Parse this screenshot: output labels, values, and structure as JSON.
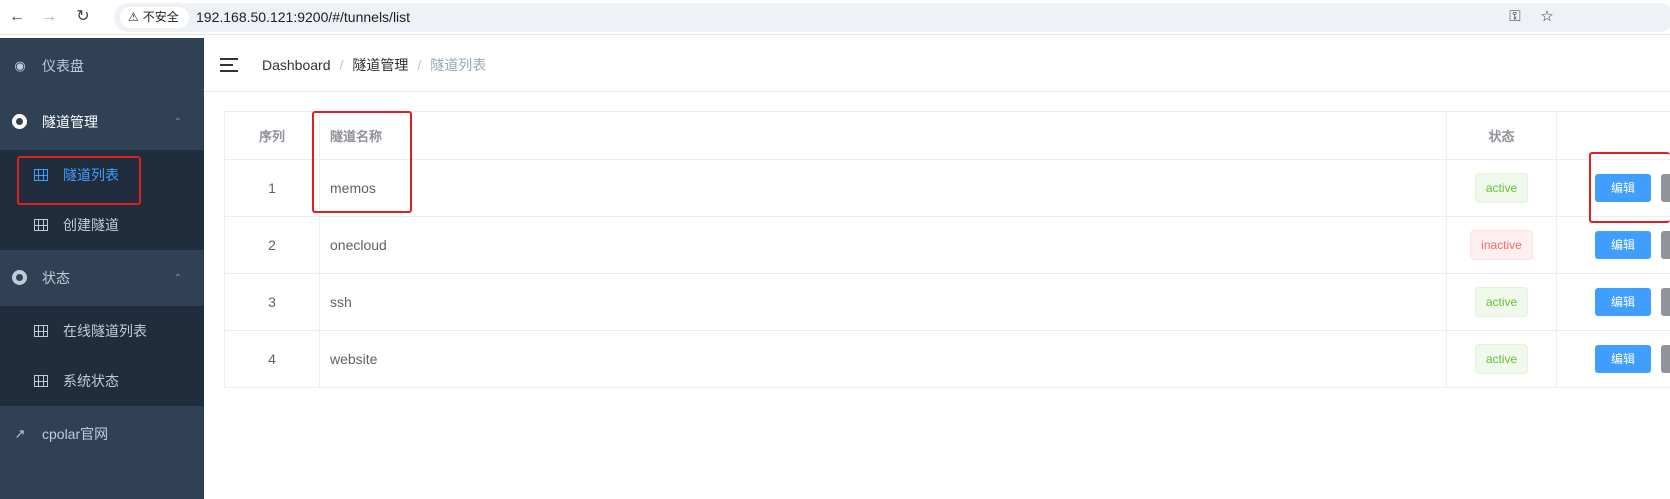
{
  "browser": {
    "security_label": "不安全",
    "url": "192.168.50.121:9200/#/tunnels/list"
  },
  "sidebar": {
    "dashboard": "仪表盘",
    "tunnel_mgmt": "隧道管理",
    "tunnel_list": "隧道列表",
    "create_tunnel": "创建隧道",
    "status": "状态",
    "online_tunnels": "在线隧道列表",
    "system_status": "系统状态",
    "cpolar_site": "cpolar官网"
  },
  "breadcrumb": {
    "home": "Dashboard",
    "section": "隧道管理",
    "current": "隧道列表",
    "separator": "/"
  },
  "table": {
    "headers": {
      "index": "序列",
      "name": "隧道名称",
      "status": "状态"
    },
    "rows": [
      {
        "index": "1",
        "name": "memos",
        "status": "active",
        "edit": "编辑"
      },
      {
        "index": "2",
        "name": "onecloud",
        "status": "inactive",
        "edit": "编辑"
      },
      {
        "index": "3",
        "name": "ssh",
        "status": "active",
        "edit": "编辑"
      },
      {
        "index": "4",
        "name": "website",
        "status": "active",
        "edit": "编辑"
      }
    ]
  },
  "colors": {
    "sidebar_bg": "#304156",
    "submenu_bg": "#1f2d3d",
    "accent": "#409eff",
    "active_tag": "#67c23a",
    "inactive_tag": "#f56c6c",
    "highlight": "#e02020"
  }
}
